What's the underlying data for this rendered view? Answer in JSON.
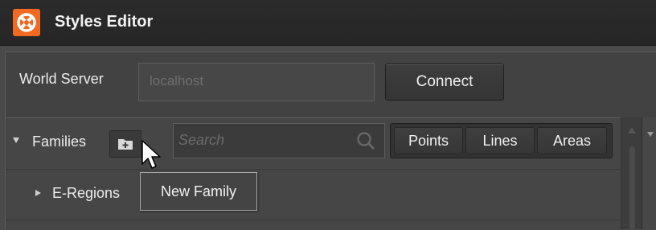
{
  "window": {
    "title": "Styles Editor",
    "logo_icon": "app-logo-icon",
    "accent_color": "#f26a21"
  },
  "server": {
    "label": "World Server",
    "input_value": "localhost",
    "connect_label": "Connect"
  },
  "families": {
    "header_label": "Families",
    "new_family_icon": "folder-add-icon",
    "search_placeholder": "Search",
    "type_filters": [
      "Points",
      "Lines",
      "Areas"
    ],
    "items": [
      {
        "label": "E-Regions",
        "expanded": false
      }
    ]
  },
  "tooltip": {
    "text": "New Family"
  }
}
